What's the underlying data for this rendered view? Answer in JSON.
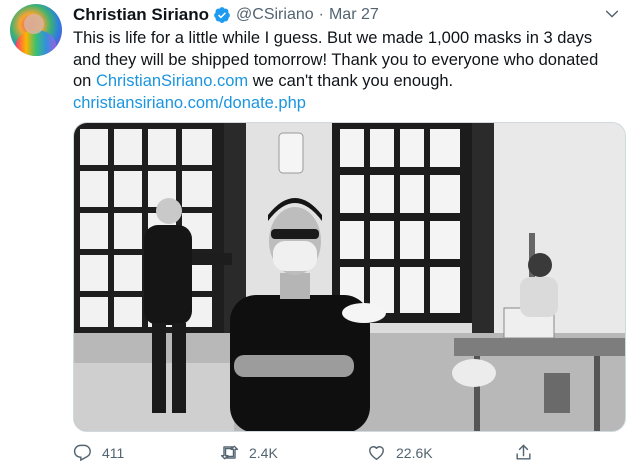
{
  "tweet": {
    "author_name": "Christian Siriano",
    "handle": "@CSiriano",
    "separator": "·",
    "date": "Mar 27",
    "verified": true,
    "text_lines": [
      "This is life for a little while I guess. But we made 1,000 masks in 3 days",
      "and they will be shipped tomorrow! Thank you to everyone who donated"
    ],
    "line3_prefix": "on ",
    "line3_link": "ChristianSiriano.com",
    "line3_suffix": " we can't thank you enough.",
    "link_line": "christiansiriano.com/donate.php"
  },
  "actions": {
    "reply_count": "411",
    "retweet_count": "2.4K",
    "like_count": "22.6K"
  },
  "icons": {
    "verified": "verified-badge-icon",
    "more": "chevron-down-icon",
    "reply": "reply-icon",
    "retweet": "retweet-icon",
    "like": "heart-icon",
    "share": "share-icon"
  },
  "colors": {
    "link": "#1b95e0",
    "verified": "#1d9bf0",
    "secondary_text": "#536471"
  }
}
